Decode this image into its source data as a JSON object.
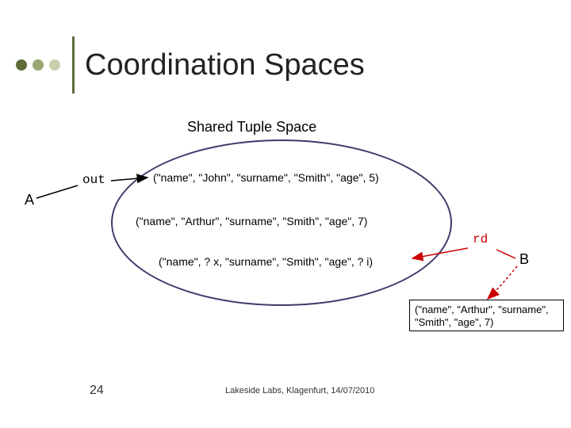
{
  "title": "Coordination Spaces",
  "subtitle": "Shared Tuple Space",
  "labels": {
    "out": "out",
    "A": "A",
    "rd": "rd",
    "B": "B"
  },
  "tuples": {
    "t1": "(\"name\", \"John\", \"surname\", \"Smith\", \"age\", 5)",
    "t2": "(\"name\", \"Arthur\", \"surname\", \"Smith\", \"age\", 7)",
    "t3": "(\"name\", ? x, \"surname\", \"Smith\", \"age\", ? i)"
  },
  "result": "(\"name\", \"Arthur\", \"surname\", \"Smith\", \"age\", 7)",
  "page_number": "24",
  "footer": "Lakeside Labs, Klagenfurt, 14/07/2010"
}
